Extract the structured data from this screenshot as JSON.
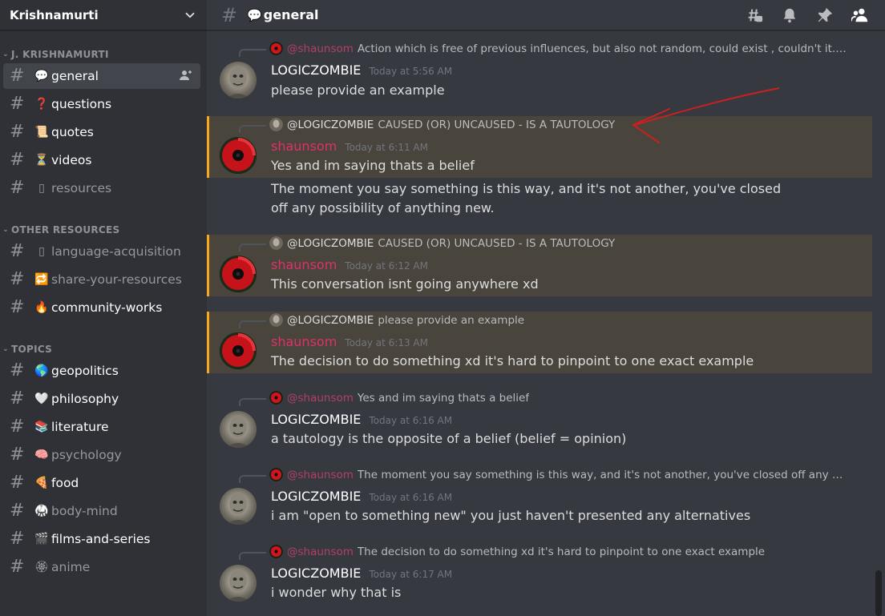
{
  "server": {
    "name": "Krishnamurti"
  },
  "sidebar": {
    "categories": [
      {
        "name": "J. KRISHNAMURTI",
        "channels": [
          {
            "emoji": "💬",
            "name": "general"
          },
          {
            "emoji": "❓",
            "name": "questions"
          },
          {
            "emoji": "📜",
            "name": "quotes"
          },
          {
            "emoji": "⏳",
            "name": "videos"
          },
          {
            "emoji": "▯",
            "name": "resources"
          }
        ]
      },
      {
        "name": "OTHER RESOURCES",
        "channels": [
          {
            "emoji": "▯",
            "name": "language-acquisition"
          },
          {
            "emoji": "🔁",
            "name": "share-your-resources"
          },
          {
            "emoji": "🔥",
            "name": "community-works"
          }
        ]
      },
      {
        "name": "TOPICS",
        "channels": [
          {
            "emoji": "🌎",
            "name": "geopolitics"
          },
          {
            "emoji": "🤍",
            "name": "philosophy"
          },
          {
            "emoji": "📚",
            "name": "literature"
          },
          {
            "emoji": "🧠",
            "name": "psychology"
          },
          {
            "emoji": "🍕",
            "name": "food"
          },
          {
            "emoji": "🥋",
            "name": "body-mind"
          },
          {
            "emoji": "🎬",
            "name": "films-and-series"
          },
          {
            "emoji": "🏵",
            "name": "anime"
          }
        ]
      }
    ]
  },
  "header": {
    "emoji": "💬",
    "channel": "general"
  },
  "messages": [
    {
      "reply_author": "@shaunsom",
      "reply_text": "Action which is free of previous influences, but also not random, could exist , couldn't it. I d...",
      "author": "LOGICZOMBIE",
      "timestamp": "Today at 5:56 AM",
      "content": "please provide an example"
    },
    {
      "reply_author": "@LOGICZOMBIE",
      "reply_text": "CAUSED (OR) UNCAUSED - IS A TAUTOLOGY",
      "author": "shaunsom",
      "timestamp": "Today at 6:11 AM",
      "content": "Yes and im saying thats a belief",
      "followup": "The moment you say something is this way, and it's not another, you've closed off any possibility of anything new."
    },
    {
      "reply_author": "@LOGICZOMBIE",
      "reply_text": "CAUSED (OR) UNCAUSED - IS A TAUTOLOGY",
      "author": "shaunsom",
      "timestamp": "Today at 6:12 AM",
      "content": "This conversation isnt going anywhere xd"
    },
    {
      "reply_author": "@LOGICZOMBIE",
      "reply_text": "please provide an example",
      "author": "shaunsom",
      "timestamp": "Today at 6:13 AM",
      "content": "The decision to do something xd it's hard to pinpoint to one exact example"
    },
    {
      "reply_author": "@shaunsom",
      "reply_text": "Yes and im saying thats a belief",
      "author": "LOGICZOMBIE",
      "timestamp": "Today at 6:16 AM",
      "content": "a tautology is the opposite of a belief (belief = opinion)"
    },
    {
      "reply_author": "@shaunsom",
      "reply_text": "The moment you say something is this way, and it's not another, you've closed off any poss...",
      "author": "LOGICZOMBIE",
      "timestamp": "Today at 6:16 AM",
      "content": "i am \"open to something new\" you just haven't presented any alternatives"
    },
    {
      "reply_author": "@shaunsom",
      "reply_text": "The decision to do something xd it's hard to pinpoint to one exact example",
      "author": "LOGICZOMBIE",
      "timestamp": "Today at 6:17 AM",
      "content": "i wonder why that is"
    }
  ],
  "colors": {
    "mention_bg": "#49443c",
    "mention_border": "#faa81a",
    "shaunsom_name": "#e0306a",
    "annotation_arrow": "#cc1f1f"
  }
}
